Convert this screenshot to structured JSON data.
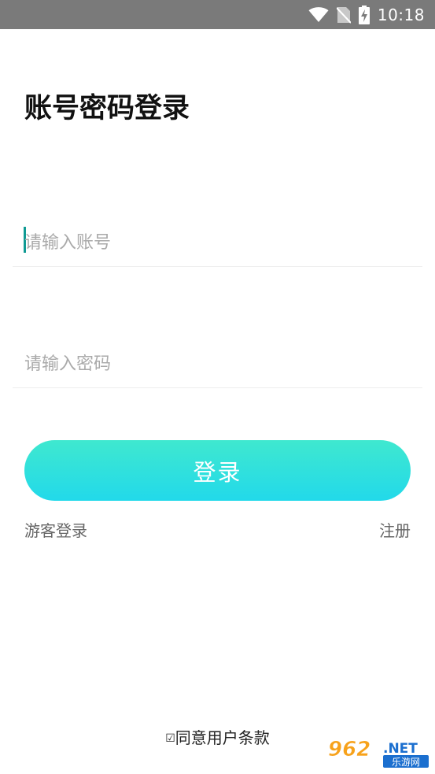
{
  "status_bar": {
    "time": "10:18",
    "icons": [
      "wifi-icon",
      "no-sim-icon",
      "battery-charging-icon"
    ]
  },
  "login": {
    "title": "账号密码登录",
    "account_placeholder": "请输入账号",
    "password_placeholder": "请输入密码",
    "login_button": "登录",
    "guest_login": "游客登录",
    "register": "注册",
    "terms_checkbox": "☑",
    "terms_label": "同意用户条款"
  },
  "watermark": {
    "number": "962",
    "domain": ".NET",
    "text": "乐游网"
  },
  "colors": {
    "status_bar": "#7a7a7a",
    "button_gradient_top": "#3fe8cf",
    "button_gradient_bottom": "#22d9ea",
    "caret": "#0f9a93",
    "watermark_orange": "#f7a21b",
    "watermark_blue": "#1b6fcf"
  }
}
